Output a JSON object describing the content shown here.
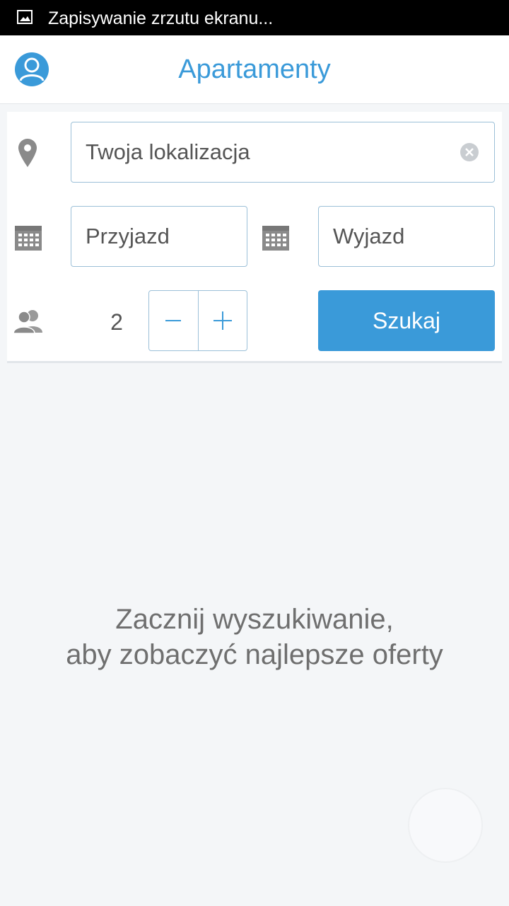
{
  "status_bar": {
    "text": "Zapisywanie zrzutu ekranu...",
    "icon": "image-icon"
  },
  "header": {
    "title": "Apartamenty",
    "avatar_icon": "user-avatar-icon"
  },
  "search": {
    "location_placeholder": "Twoja lokalizacja",
    "arrival_placeholder": "Przyjazd",
    "departure_placeholder": "Wyjazd",
    "guests": "2",
    "minus_label": "−",
    "plus_label": "+",
    "search_label": "Szukaj"
  },
  "empty_state": {
    "line1": "Zacznij wyszukiwanie,",
    "line2": "aby zobaczyć najlepsze oferty"
  },
  "colors": {
    "accent": "#3a9ad9",
    "border": "#9cc0d8",
    "icon_gray": "#8a8a8a"
  }
}
